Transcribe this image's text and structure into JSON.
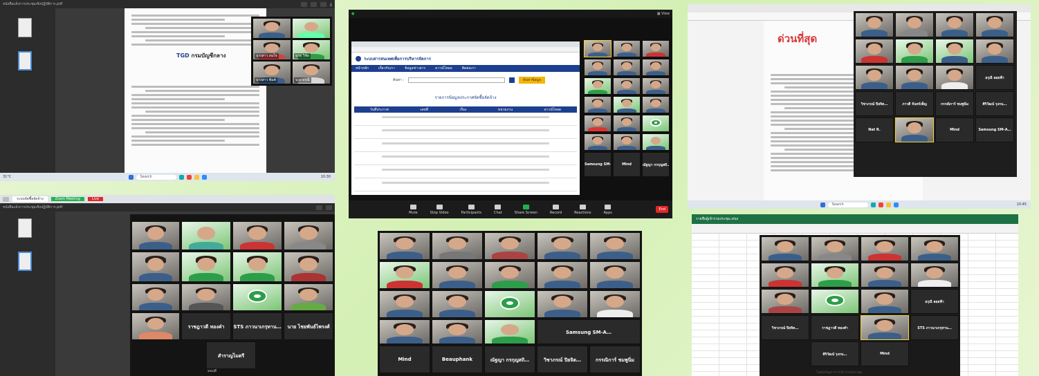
{
  "panel_top_left": {
    "title": "หนังสือแจ้งการประชุมเชิงปฏิบัติการ.pdf",
    "doc_org": "กรมบัญชีกลาง",
    "participants": [
      "นางสาว สมใจ",
      "นาย วิชัย",
      "นางสาว พิมพ์",
      "นาง อรุณี"
    ],
    "weather": "31°C",
    "search_placeholder": "Search",
    "clock": "10:30"
  },
  "panel_top_middle": {
    "site_title": "ระบบสารสนเทศเพื่อการบริหารจัดการ",
    "nav": [
      "หน้าหลัก",
      "เกี่ยวกับเรา",
      "ข้อมูลข่าวสาร",
      "ดาวน์โหลด",
      "ติดต่อเรา"
    ],
    "search_label": "ค้นหา :",
    "search_button": "ค้นหาข้อมูล",
    "table_heading": "รายการข้อมูลประกาศจัดซื้อจัดจ้าง",
    "table_headers": [
      "วันที่ประกาศ",
      "เลขที่",
      "เรื่อง",
      "หน่วยงาน",
      "ดาวน์โหลด"
    ],
    "side_names": [
      "Samsung SM-A…",
      "Mind",
      "ณัฐญา กรกุญสถิ…"
    ],
    "toolbar": [
      "Mute",
      "Stop Video",
      "Participants",
      "Chat",
      "Share Screen",
      "Record",
      "Reactions",
      "Apps"
    ],
    "end_label": "End"
  },
  "panel_top_right": {
    "doc_urgent": "ด่วนที่สุด",
    "grid_names": [
      "อรุณี ลอยฟ้า",
      "วิชาภรณ์ ปิยจิต…",
      "ภาวดี จันทร์เพ็ญ",
      "กรรณิการ์ ชมพูนิ่ม",
      "Nat R.",
      "ศิริวัฒน์ รุงกน…",
      "Mind",
      "Samsung SM-A…"
    ],
    "search_placeholder": "Search",
    "clock": "10:45"
  },
  "panel_bottom_left": {
    "grid_names": [
      "ราชฎาวดี ทองคำ",
      "STS ภาวนาเกรุทาน…",
      "นาย ไชยพันธ์ไพรงศ์",
      "สำราญไมตรี"
    ],
    "footer_name": "มนฤดี"
  },
  "panel_bottom_middle": {
    "grid_names": [
      "Mind",
      "Beauphank",
      "ณัฐญา กรกุญสถิ…",
      "วิชาภรณ์ ปิยจิต…",
      "กรรณิการ์ ชมพูนิ่ม",
      "Samsung SM-A…"
    ]
  },
  "panel_bottom_right": {
    "sheet_title": "รายชื่อผู้เข้าร่วมประชุม.xlsx",
    "grid_names": [
      "อรุณี ลอยฟ้า",
      "วิชาภรณ์ ปิยจิต…",
      "ราชฎาวดี ทองคำ",
      "STS ภาวนาเกรุทาน…",
      "ศิริวัฒน์ รุงกน…",
      "Mind"
    ],
    "status": "ไม่พบปัญหาการเข้าร่วมประชุม"
  },
  "colors": {
    "accent_green": "#22b14c",
    "nav_blue": "#1d3f8f",
    "end_red": "#e02828"
  }
}
